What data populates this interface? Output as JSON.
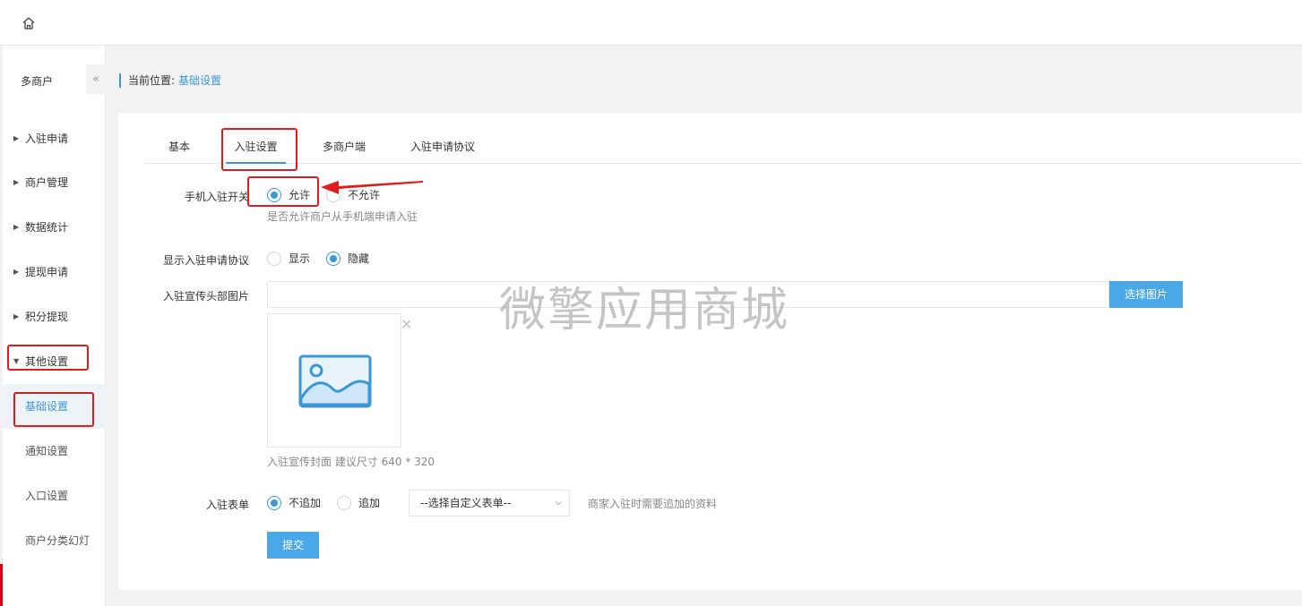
{
  "header": {
    "home_icon": "home-icon"
  },
  "sidebar": {
    "title": "多商户",
    "collapse_glyph": "«",
    "items": [
      {
        "label": "入驻申请"
      },
      {
        "label": "商户管理"
      },
      {
        "label": "数据统计"
      },
      {
        "label": "提现申请"
      },
      {
        "label": "积分提现"
      },
      {
        "label": "其他设置"
      }
    ],
    "sub_items": [
      {
        "label": "基础设置",
        "active": true
      },
      {
        "label": "通知设置"
      },
      {
        "label": "入口设置"
      },
      {
        "label": "商户分类幻灯"
      }
    ]
  },
  "breadcrumb": {
    "prefix": "当前位置:",
    "current": "基础设置"
  },
  "tabs": [
    {
      "label": "基本"
    },
    {
      "label": "入驻设置",
      "active": true
    },
    {
      "label": "多商户端"
    },
    {
      "label": "入驻申请协议"
    }
  ],
  "form": {
    "mobile_switch": {
      "label": "手机入驻开关",
      "options": [
        "允许",
        "不允许"
      ],
      "selected": "允许",
      "help": "是否允许商户从手机端申请入驻"
    },
    "show_agreement": {
      "label": "显示入驻申请协议",
      "options": [
        "显示",
        "隐藏"
      ],
      "selected": "隐藏"
    },
    "header_image": {
      "label": "入驻宣传头部图片",
      "value": "",
      "button": "选择图片",
      "close": "×",
      "help": "入驻宣传封面 建议尺寸 640 * 320"
    },
    "entry_form": {
      "label": "入驻表单",
      "options": [
        "不追加",
        "追加"
      ],
      "selected": "不追加",
      "select_value": "--选择自定义表单--",
      "help": "商家入驻时需要追加的资料"
    },
    "submit": "提交"
  },
  "watermark": "微擎应用商城",
  "colors": {
    "accent": "#3a97d8",
    "button": "#4aa8e8",
    "annotation": "#e21b1b"
  }
}
